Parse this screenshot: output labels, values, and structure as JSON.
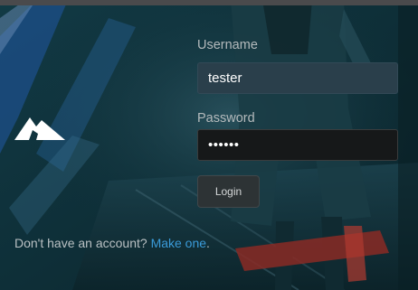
{
  "login": {
    "username_label": "Username",
    "username_value": "tester",
    "password_label": "Password",
    "password_value": "tester",
    "button_label": "Login"
  },
  "signup": {
    "prompt": "Don't have an account?",
    "link": "Make one",
    "suffix": "."
  },
  "logo": {
    "icon": "mountain-icon",
    "color": "#ffffff"
  },
  "colors": {
    "background": "#0d2b33",
    "link": "#3a9bd9",
    "accent_red": "#c0392b"
  }
}
